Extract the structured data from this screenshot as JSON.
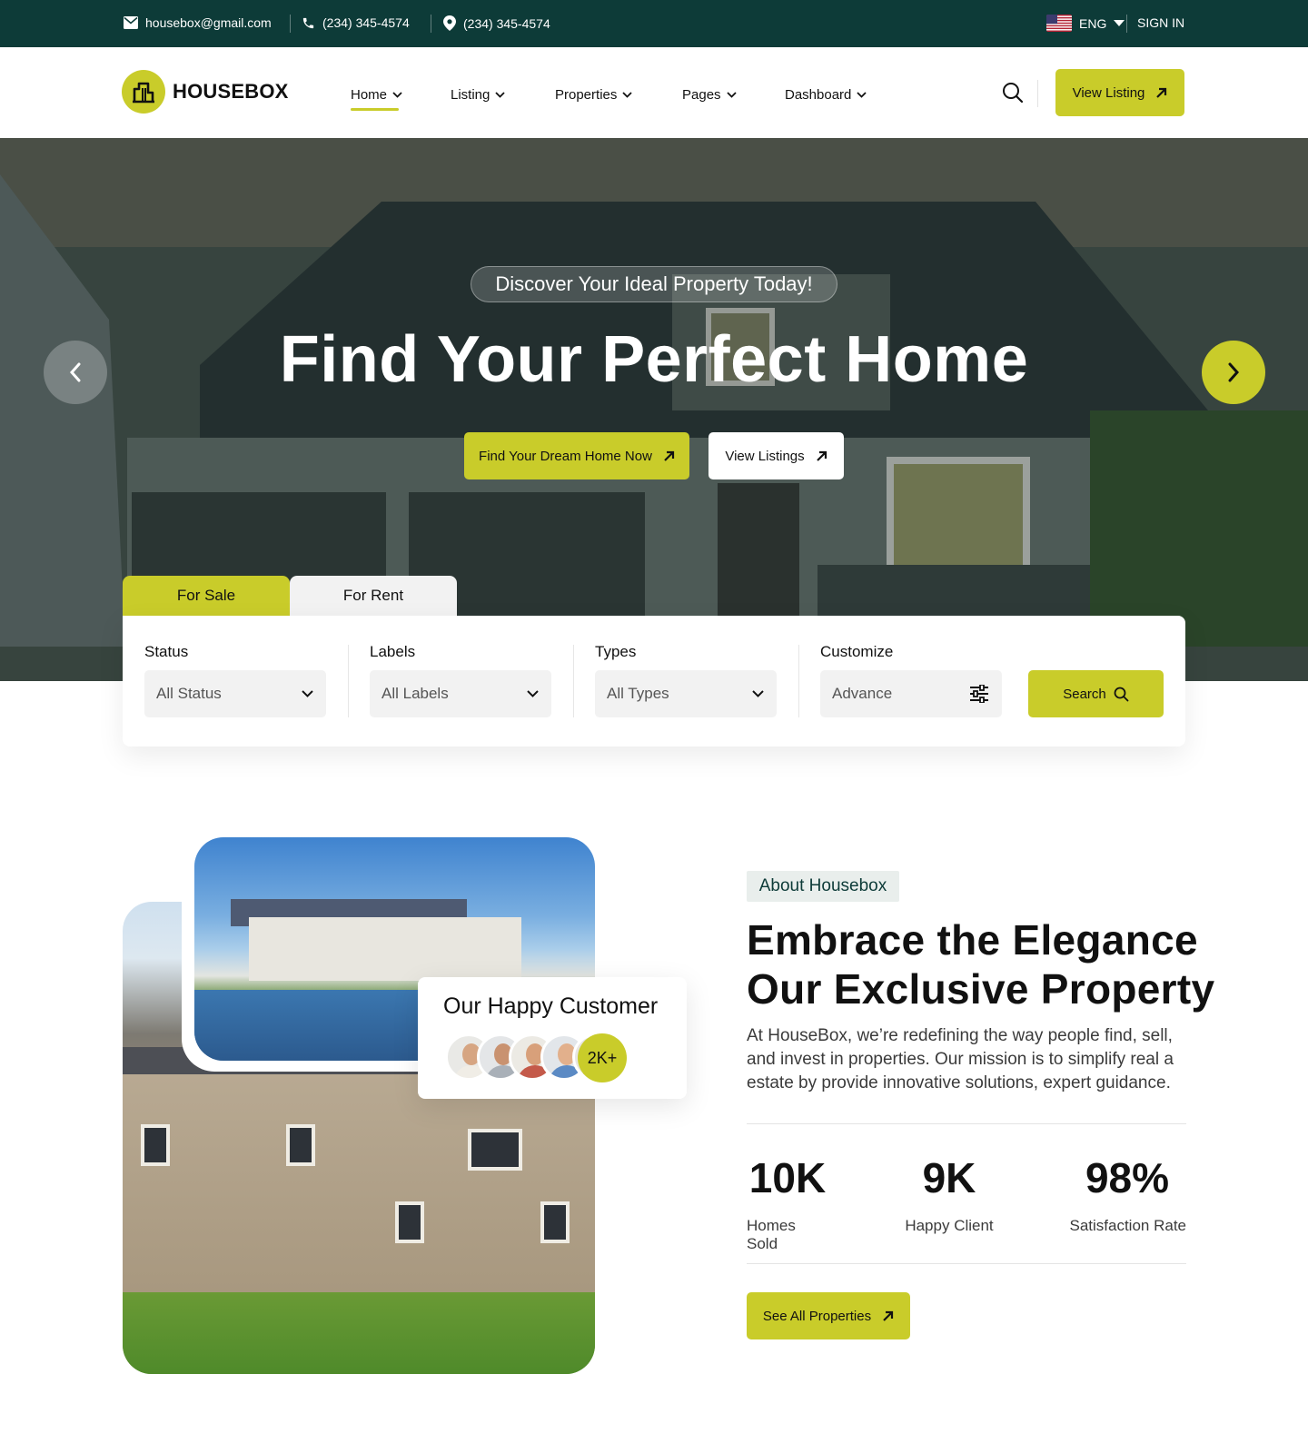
{
  "topbar": {
    "email": "housebox@gmail.com",
    "phone": "(234) 345-4574",
    "location": "(234) 345-4574",
    "language": "ENG",
    "signin": "SIGN IN"
  },
  "header": {
    "logo": "HOUSEBOX",
    "nav": [
      "Home",
      "Listing",
      "Properties",
      "Pages",
      "Dashboard"
    ],
    "active_nav": "Home",
    "cta": "View Listing"
  },
  "hero": {
    "tagline": "Discover Your Ideal Property Today!",
    "title": "Find Your Perfect Home",
    "primary_button": "Find Your Dream Home Now",
    "secondary_button": "View Listings"
  },
  "search": {
    "tabs": [
      "For Sale",
      "For Rent"
    ],
    "active_tab": "For Sale",
    "fields": [
      {
        "label": "Status",
        "value": "All Status"
      },
      {
        "label": "Labels",
        "value": "All Labels"
      },
      {
        "label": "Types",
        "value": "All Types"
      },
      {
        "label": "Customize",
        "value": "Advance"
      }
    ],
    "button": "Search"
  },
  "about": {
    "tag": "About Housebox",
    "title_line1": "Embrace the Elegance",
    "title_line2": "Our Exclusive Property",
    "text": "At HouseBox, we’re redefining the way people find, sell, and invest in properties. Our mission is to simplify real a estate by provide innovative solutions, expert guidance.",
    "happy_customer": "Our Happy Customer",
    "customer_badge": "2K+",
    "stats": [
      {
        "value": "10K",
        "label": "Homes Sold"
      },
      {
        "value": "9K",
        "label": "Happy Client"
      },
      {
        "value": "98%",
        "label": "Satisfaction Rate"
      }
    ],
    "button": "See All Properties"
  },
  "colors": {
    "accent": "#c9cc2a",
    "dark": "#0d3b38"
  }
}
